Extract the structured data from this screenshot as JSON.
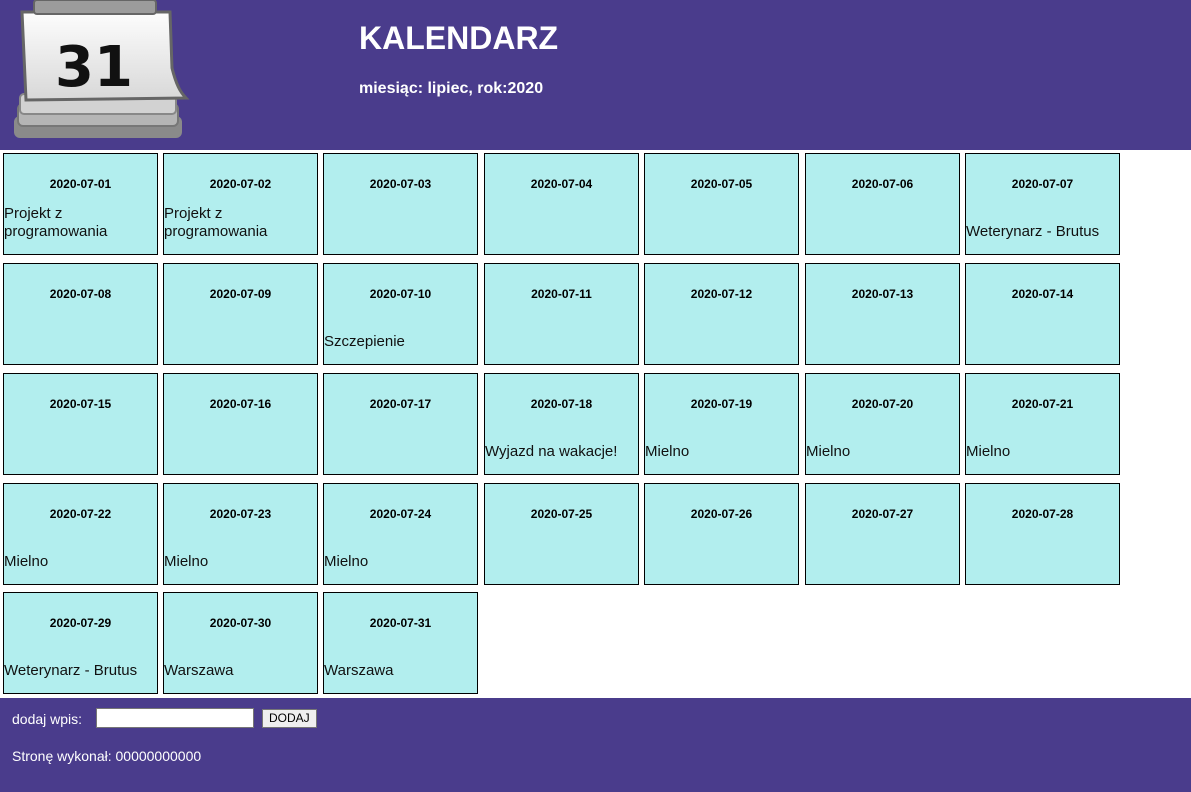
{
  "header": {
    "logo_text": "31",
    "title": "KALENDARZ",
    "subtitle": "miesiąc: lipiec, rok:2020"
  },
  "colors": {
    "header_bg": "#4a3c8c",
    "day_bg": "#b2eeee"
  },
  "icons": {
    "logo": "calendar-31-icon"
  },
  "days": [
    {
      "date": "2020-07-01",
      "note": "Projekt z programowania"
    },
    {
      "date": "2020-07-02",
      "note": "Projekt z programowania"
    },
    {
      "date": "2020-07-03",
      "note": ""
    },
    {
      "date": "2020-07-04",
      "note": ""
    },
    {
      "date": "2020-07-05",
      "note": ""
    },
    {
      "date": "2020-07-06",
      "note": ""
    },
    {
      "date": "2020-07-07",
      "note": "Weterynarz - Brutus"
    },
    {
      "date": "2020-07-08",
      "note": ""
    },
    {
      "date": "2020-07-09",
      "note": ""
    },
    {
      "date": "2020-07-10",
      "note": "Szczepienie"
    },
    {
      "date": "2020-07-11",
      "note": ""
    },
    {
      "date": "2020-07-12",
      "note": ""
    },
    {
      "date": "2020-07-13",
      "note": ""
    },
    {
      "date": "2020-07-14",
      "note": ""
    },
    {
      "date": "2020-07-15",
      "note": ""
    },
    {
      "date": "2020-07-16",
      "note": ""
    },
    {
      "date": "2020-07-17",
      "note": ""
    },
    {
      "date": "2020-07-18",
      "note": "Wyjazd na wakacje!"
    },
    {
      "date": "2020-07-19",
      "note": "Mielno"
    },
    {
      "date": "2020-07-20",
      "note": "Mielno"
    },
    {
      "date": "2020-07-21",
      "note": "Mielno"
    },
    {
      "date": "2020-07-22",
      "note": "Mielno"
    },
    {
      "date": "2020-07-23",
      "note": "Mielno"
    },
    {
      "date": "2020-07-24",
      "note": "Mielno"
    },
    {
      "date": "2020-07-25",
      "note": ""
    },
    {
      "date": "2020-07-26",
      "note": ""
    },
    {
      "date": "2020-07-27",
      "note": ""
    },
    {
      "date": "2020-07-28",
      "note": ""
    },
    {
      "date": "2020-07-29",
      "note": "Weterynarz - Brutus"
    },
    {
      "date": "2020-07-30",
      "note": "Warszawa"
    },
    {
      "date": "2020-07-31",
      "note": "Warszawa"
    }
  ],
  "footer": {
    "add_label": "dodaj wpis:",
    "input_value": "",
    "button_label": "DODAJ",
    "author_text": "Stronę wykonał: 00000000000"
  }
}
